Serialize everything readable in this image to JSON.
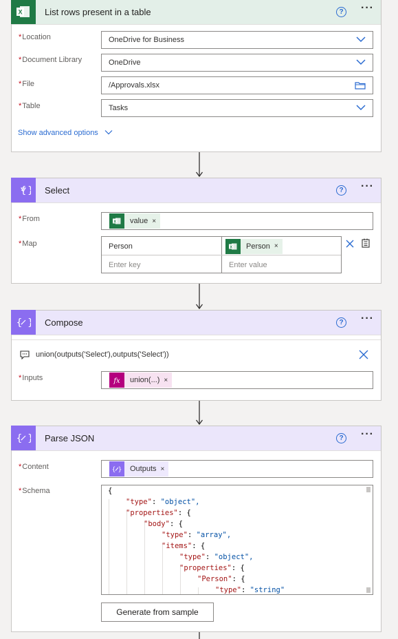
{
  "list_rows": {
    "title": "List rows present in a table",
    "fields": [
      {
        "label": "Location",
        "value": "OneDrive for Business"
      },
      {
        "label": "Document Library",
        "value": "OneDrive"
      },
      {
        "label": "File",
        "value": "/Approvals.xlsx"
      },
      {
        "label": "Table",
        "value": "Tasks"
      }
    ],
    "advanced_link": "Show advanced options"
  },
  "select": {
    "title": "Select",
    "from_label": "From",
    "from_token": "value",
    "map_label": "Map",
    "map_key": "Person",
    "map_value_token": "Person",
    "key_placeholder": "Enter key",
    "value_placeholder": "Enter value"
  },
  "compose": {
    "title": "Compose",
    "comment": "union(outputs('Select'),outputs('Select'))",
    "inputs_label": "Inputs",
    "inputs_token": "union(...)"
  },
  "parse_json": {
    "title": "Parse JSON",
    "content_label": "Content",
    "content_token": "Outputs",
    "schema_label": "Schema",
    "schema_lines": [
      {
        "k": "",
        "v": "{"
      },
      {
        "k": "\"type\"",
        "v": "\"object\","
      },
      {
        "k": "\"properties\"",
        "v": "{"
      },
      {
        "k": "\"body\"",
        "v": "{"
      },
      {
        "k": "\"type\"",
        "v": "\"array\","
      },
      {
        "k": "\"items\"",
        "v": "{"
      },
      {
        "k": "\"type\"",
        "v": "\"object\","
      },
      {
        "k": "\"properties\"",
        "v": "{"
      },
      {
        "k": "\"Person\"",
        "v": "{"
      },
      {
        "k": "\"type\"",
        "v": "\"string\""
      }
    ],
    "generate_button": "Generate from sample"
  },
  "common": {
    "help_glyph": "?",
    "more_glyph": "···",
    "required_mark": "*",
    "token_remove": "×"
  },
  "colors": {
    "excel": "#1f7a45",
    "operation": "#8b6df0",
    "expression": "#b4007e",
    "link": "#2a6bd1"
  }
}
